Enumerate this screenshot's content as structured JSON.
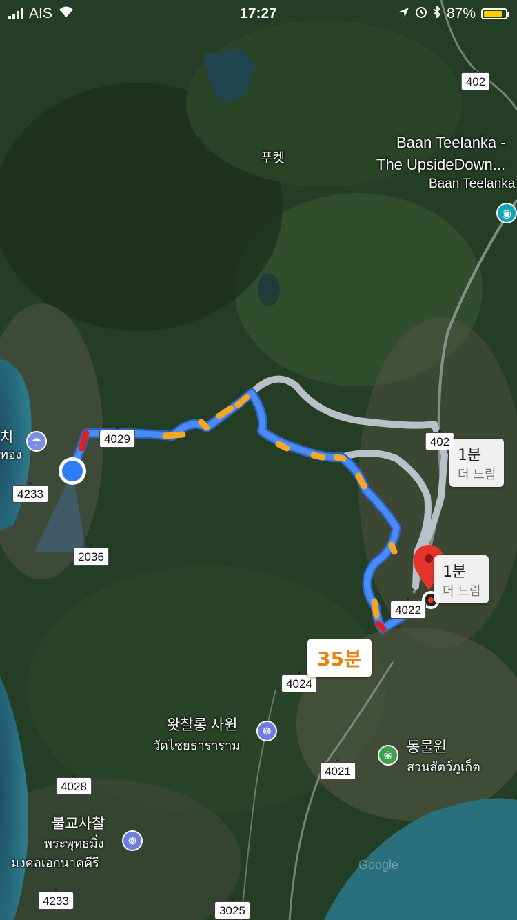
{
  "status_bar": {
    "carrier": "AIS",
    "time": "17:27",
    "battery_percent": "87%",
    "battery_level": 0.87,
    "icons": [
      "signal-icon",
      "wifi-icon",
      "location-arrow-icon",
      "alarm-icon",
      "bluetooth-icon",
      "battery-icon"
    ]
  },
  "map": {
    "road_shields": [
      "402",
      "4029",
      "4233",
      "2036",
      "402",
      "4022",
      "4024",
      "4021",
      "4028",
      "4233",
      "3025"
    ],
    "labels": {
      "phuket": "푸켓",
      "baan_line1": "Baan Teelanka -",
      "baan_line2": "The UpsideDown...",
      "baan_sub": "Baan Teelanka",
      "beach_partial": "치",
      "beach_partial_thai": "ทอง",
      "wat_chalong_ko": "왓찰롱 사원",
      "wat_chalong_th": "วัดไชยธาราราม",
      "zoo_ko": "동물원",
      "zoo_th": "สวนสัตว์ภูเก็ต",
      "temple_ko": "불교사찰",
      "temple_th1": "พระพุทธมิ่ง",
      "temple_th2": "มงคลเอกนาคคีรี",
      "watermark": "Google"
    },
    "route_eta": "35분",
    "alt_route_1": {
      "time": "1분",
      "note": "더 느림"
    },
    "alt_route_2": {
      "time": "1분",
      "note": "더 느림"
    },
    "colors": {
      "route": "#4a8cf7",
      "traffic_slow": "#f5a623",
      "traffic_jam": "#e0201b",
      "alt_route": "#b9c0c8",
      "destination": "#e5342a"
    }
  }
}
